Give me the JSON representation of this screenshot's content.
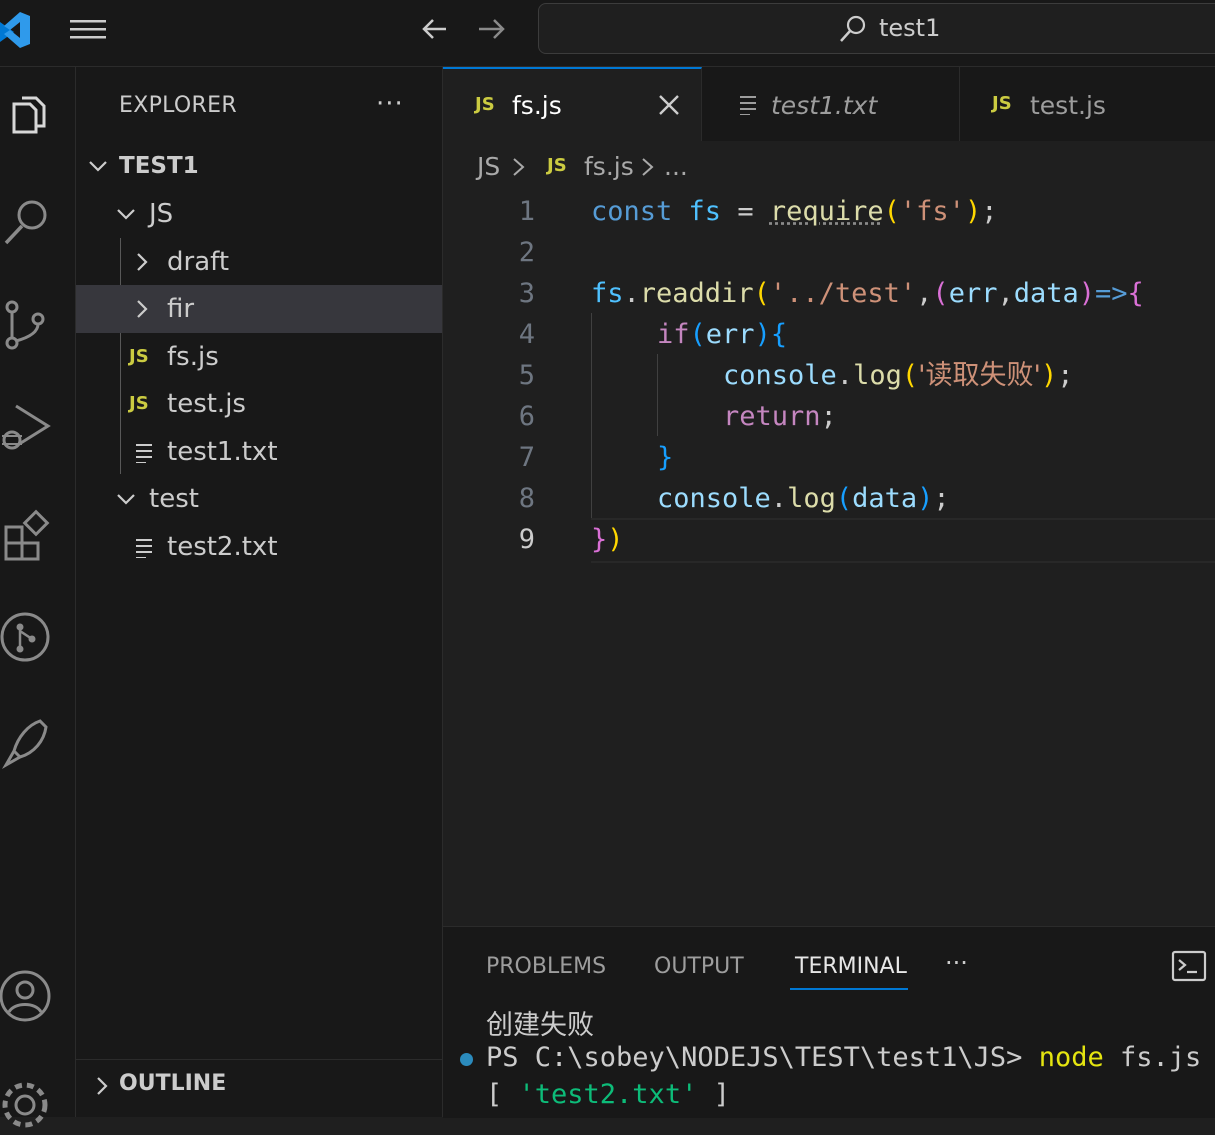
{
  "titlebar": {
    "search_text": "test1",
    "icons": [
      "vscode-logo",
      "hamburger-menu-icon",
      "arrow-left-icon",
      "arrow-right-icon",
      "search-icon"
    ]
  },
  "activitybar": {
    "items": [
      "explorer-icon",
      "search-icon",
      "source-control-icon",
      "run-debug-icon",
      "extensions-icon",
      "git-graph-icon",
      "rocket-icon",
      "account-icon",
      "settings-gear-icon"
    ]
  },
  "sidebar": {
    "title": "EXPLORER",
    "more": "···",
    "root": "TEST1",
    "tree": {
      "js_folder": "JS",
      "draft": "draft",
      "fir": "fir",
      "fs_js": "fs.js",
      "test_js": "test.js",
      "test1_txt": "test1.txt",
      "test_folder": "test",
      "test2_txt": "test2.txt",
      "js_badge": "JS"
    },
    "outline": "OUTLINE"
  },
  "tabs": [
    {
      "label": "fs.js",
      "icon": "JS"
    },
    {
      "label": "test1.txt"
    },
    {
      "label": "test.js",
      "icon": "JS"
    }
  ],
  "breadcrumb": {
    "folder": "JS",
    "file_icon": "JS",
    "file": "fs.js",
    "more": "..."
  },
  "editor": {
    "line_numbers": [
      "1",
      "2",
      "3",
      "4",
      "5",
      "6",
      "7",
      "8",
      "9"
    ],
    "current_line": 9,
    "tokens": {
      "const": "const",
      "fs": "fs",
      "eq": " = ",
      "require": "require",
      "fs_str": "'fs'",
      "semi": ";",
      "readdir": "readdir",
      "path_str": "'../test'",
      "err": "err",
      "data": "data",
      "arrow": "=>",
      "if": "if",
      "console": "console",
      "log": "log",
      "fail_str": "'读取失败'",
      "return": "return"
    }
  },
  "panel": {
    "tabs": [
      "PROBLEMS",
      "OUTPUT",
      "TERMINAL"
    ],
    "active_tab": "TERMINAL",
    "more": "···",
    "terminal_lines": {
      "line1": "创建失败",
      "prompt": "PS C:\\sobey\\NODEJS\\TEST\\test1\\JS> ",
      "command": "node",
      "arg": " fs.js",
      "out_open": "[ ",
      "out_str": "'test2.txt'",
      "out_close": " ]"
    }
  }
}
